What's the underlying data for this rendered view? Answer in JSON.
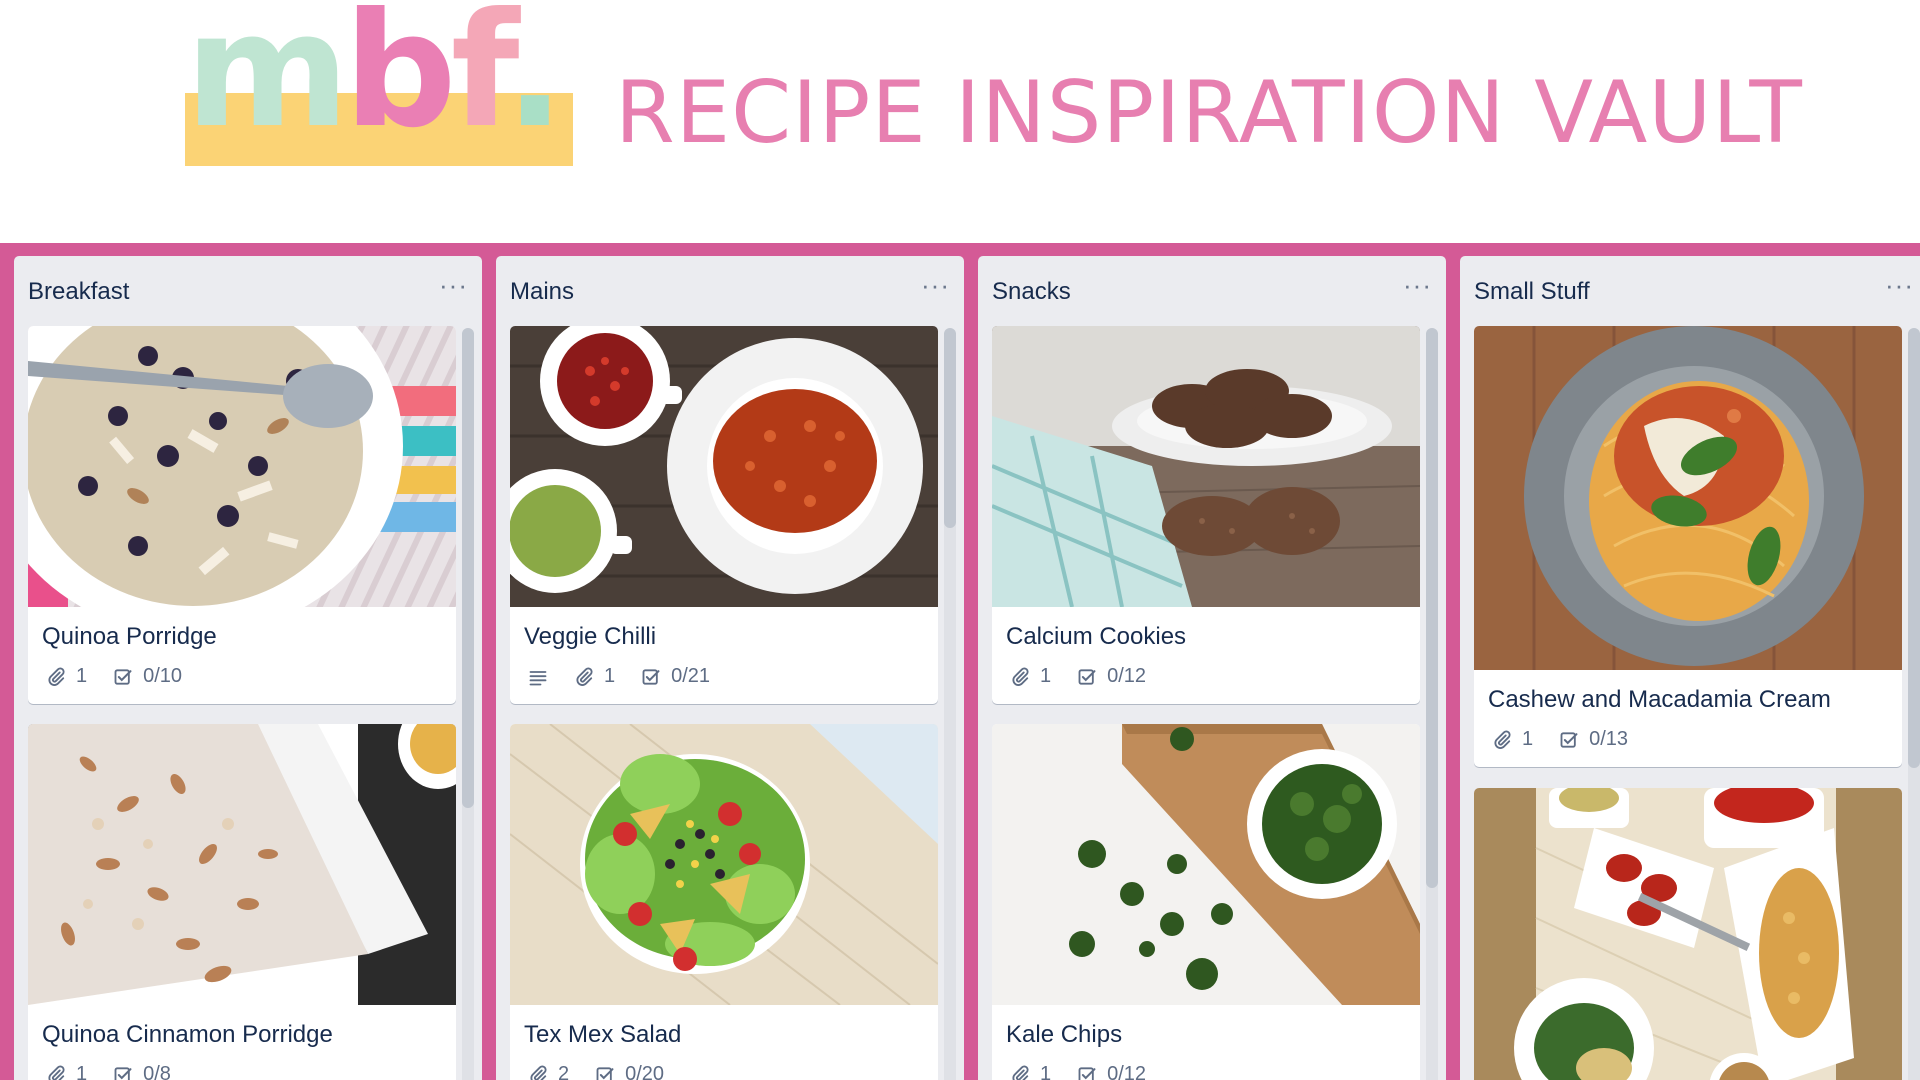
{
  "header": {
    "logo": {
      "m": "m",
      "b": "b",
      "f": "f",
      "dot": "."
    },
    "title": "RECIPE INSPIRATION VAULT"
  },
  "colors": {
    "board": "#d45a96",
    "title": "#e77fb0",
    "logo_bar": "#fbd375"
  },
  "lists": [
    {
      "title": "Breakfast",
      "menu": "···",
      "cards": [
        {
          "title": "Quinoa Porridge",
          "attachments": "1",
          "checklist": "0/10",
          "description": false,
          "cover": "quinoa-porridge-photo"
        },
        {
          "title": "Quinoa Cinnamon Porridge",
          "attachments": "1",
          "checklist": "0/8",
          "description": false,
          "cover": "cinnamon-porridge-photo"
        }
      ]
    },
    {
      "title": "Mains",
      "menu": "···",
      "cards": [
        {
          "title": "Veggie Chilli",
          "attachments": "1",
          "checklist": "0/21",
          "description": true,
          "cover": "veggie-chilli-photo"
        },
        {
          "title": "Tex Mex Salad",
          "attachments": "2",
          "checklist": "0/20",
          "description": false,
          "cover": "tex-mex-salad-photo"
        }
      ]
    },
    {
      "title": "Snacks",
      "menu": "···",
      "cards": [
        {
          "title": "Calcium Cookies",
          "attachments": "1",
          "checklist": "0/12",
          "description": false,
          "cover": "calcium-cookies-photo"
        },
        {
          "title": "Kale Chips",
          "attachments": "1",
          "checklist": "0/12",
          "description": false,
          "cover": "kale-chips-photo"
        }
      ]
    },
    {
      "title": "Small Stuff",
      "menu": "···",
      "cards": [
        {
          "title": "Cashew and Macadamia Cream",
          "attachments": "1",
          "checklist": "0/13",
          "description": false,
          "cover": "spaghetti-cashew-cream-photo"
        },
        {
          "title": "",
          "attachments": "",
          "checklist": "",
          "description": false,
          "cover": "condiments-spread-photo"
        }
      ]
    }
  ]
}
